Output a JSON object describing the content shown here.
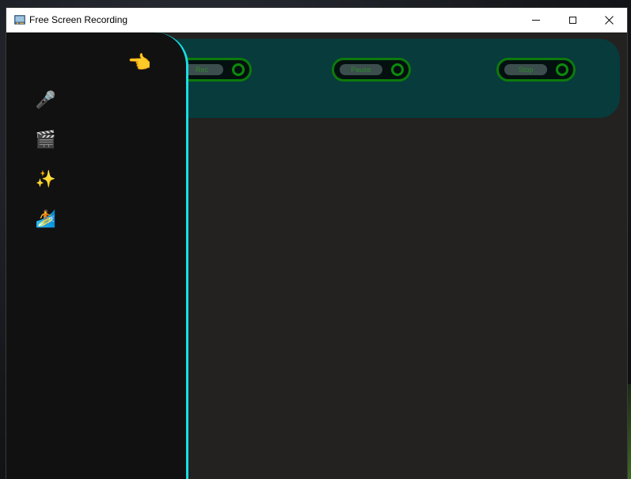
{
  "window": {
    "title": "Free Screen Recording"
  },
  "titlebar_controls": {
    "minimize": "minimize-icon",
    "maximize": "maximize-icon",
    "close": "close-icon"
  },
  "sidebar": {
    "toggle_icon": "👈",
    "items": [
      {
        "icon": "🎤",
        "name": "microphone-icon"
      },
      {
        "icon": "🎬",
        "name": "clapper-board-icon"
      },
      {
        "icon": "✨",
        "name": "sparkles-icon"
      },
      {
        "icon": "🏄",
        "name": "surfer-icon"
      }
    ],
    "accent_color": "#17dfe6"
  },
  "top_panel": {
    "background_color": "#083b3b",
    "toggles": [
      {
        "label": "Rec"
      },
      {
        "label": "Pause"
      },
      {
        "label": "Stop"
      }
    ],
    "toggle_color": "#0c7a0c"
  }
}
